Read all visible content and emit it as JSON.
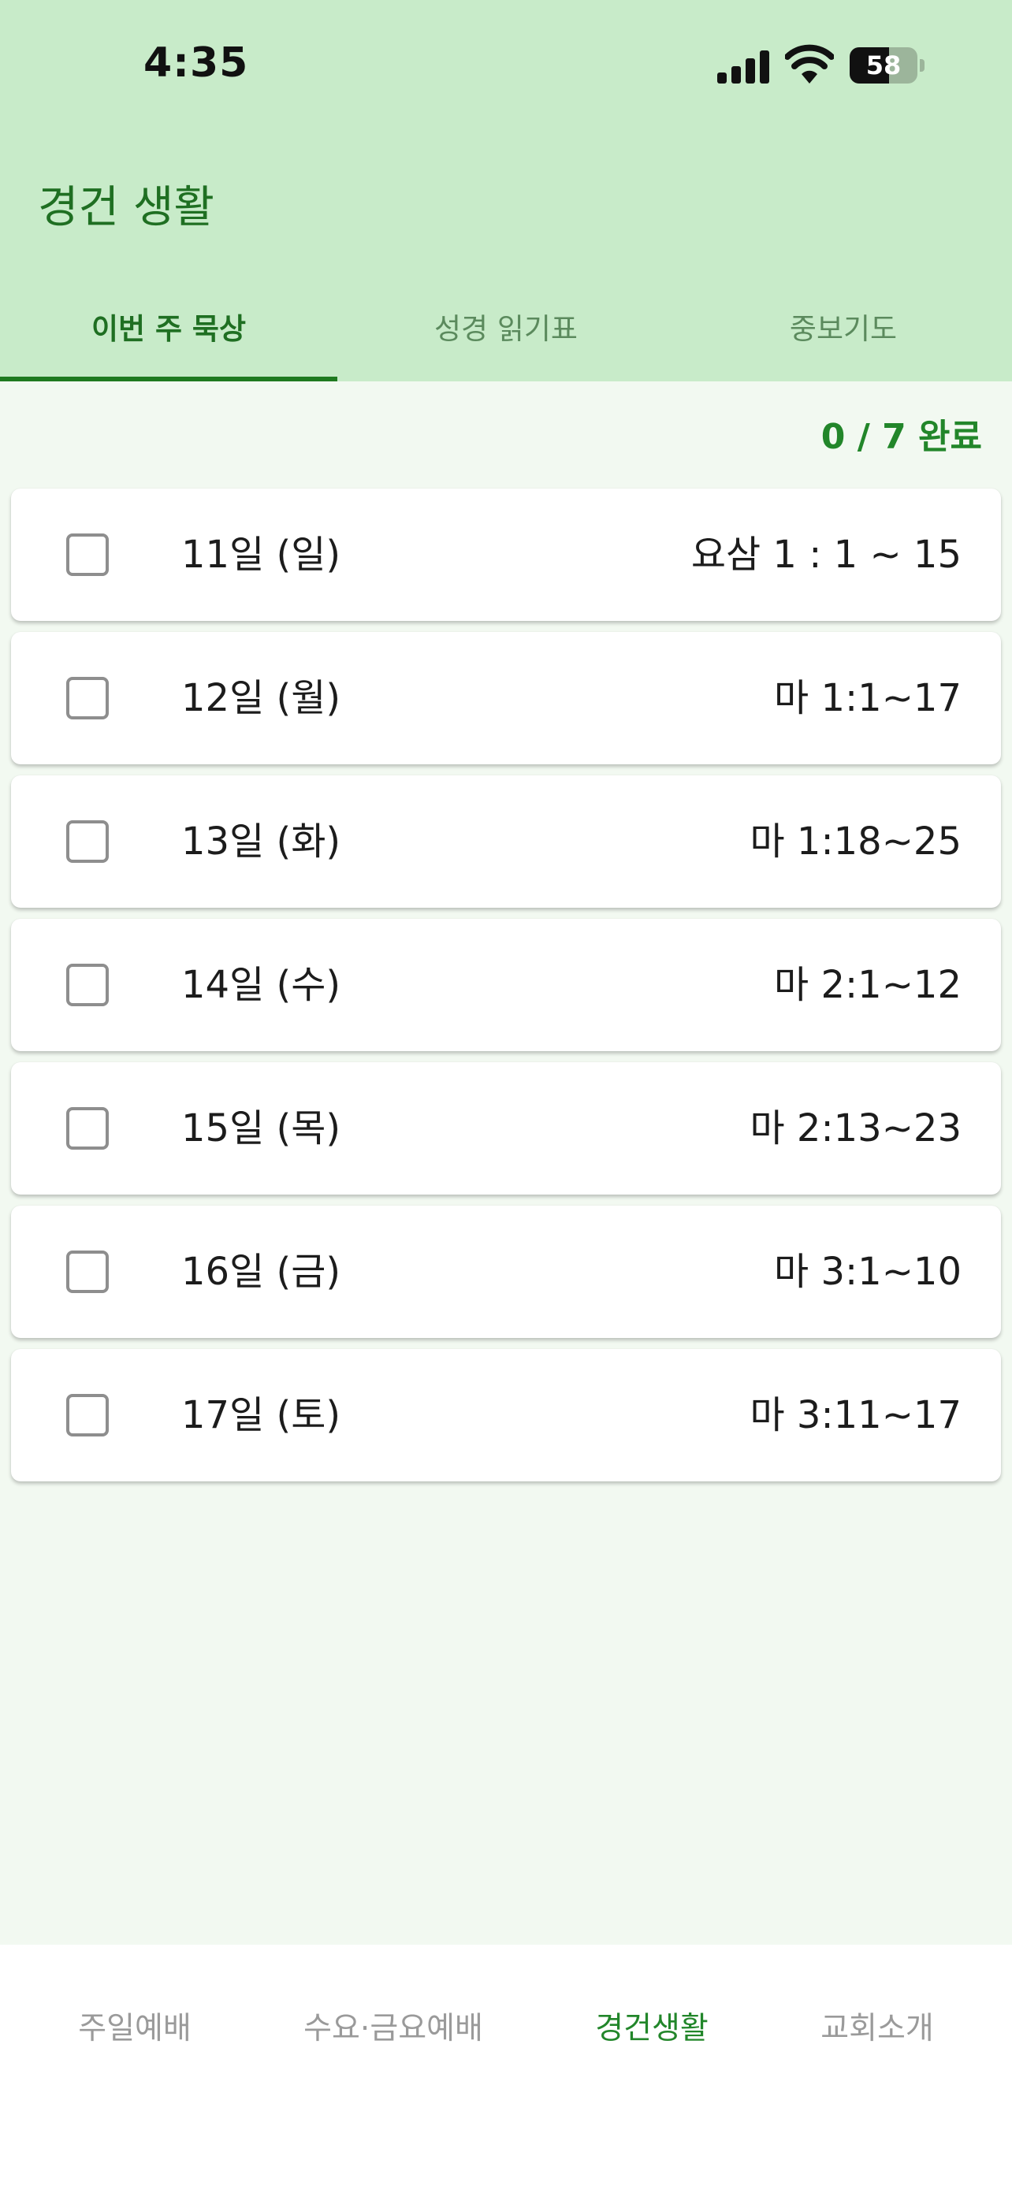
{
  "status_bar": {
    "time": "4:35",
    "battery_level": "58",
    "icons": [
      "cellular-signal-icon",
      "wifi-icon",
      "battery-icon"
    ]
  },
  "header": {
    "title": "경건 생활",
    "tabs": [
      {
        "label": "이번 주 묵상",
        "active": true
      },
      {
        "label": "성경 읽기표",
        "active": false
      },
      {
        "label": "중보기도",
        "active": false
      }
    ]
  },
  "main": {
    "progress_text": "0 / 7 완료",
    "readings": [
      {
        "day": "11일 (일)",
        "passage": "요삼 1 : 1 ~ 15",
        "checked": false
      },
      {
        "day": "12일 (월)",
        "passage": "마 1:1~17",
        "checked": false
      },
      {
        "day": "13일 (화)",
        "passage": "마 1:18~25",
        "checked": false
      },
      {
        "day": "14일 (수)",
        "passage": "마 2:1~12",
        "checked": false
      },
      {
        "day": "15일 (목)",
        "passage": "마 2:13~23",
        "checked": false
      },
      {
        "day": "16일 (금)",
        "passage": "마 3:1~10",
        "checked": false
      },
      {
        "day": "17일 (토)",
        "passage": "마 3:11~17",
        "checked": false
      }
    ]
  },
  "bottom_nav": {
    "items": [
      {
        "label": "주일예배",
        "active": false
      },
      {
        "label": "수요·금요예배",
        "active": false
      },
      {
        "label": "경건생활",
        "active": true
      },
      {
        "label": "교회소개",
        "active": false
      }
    ]
  },
  "colors": {
    "header_background": "#c8ebc9",
    "accent_green": "#22862a",
    "title_green": "#1f6f22",
    "page_background": "#f2f9f1"
  }
}
